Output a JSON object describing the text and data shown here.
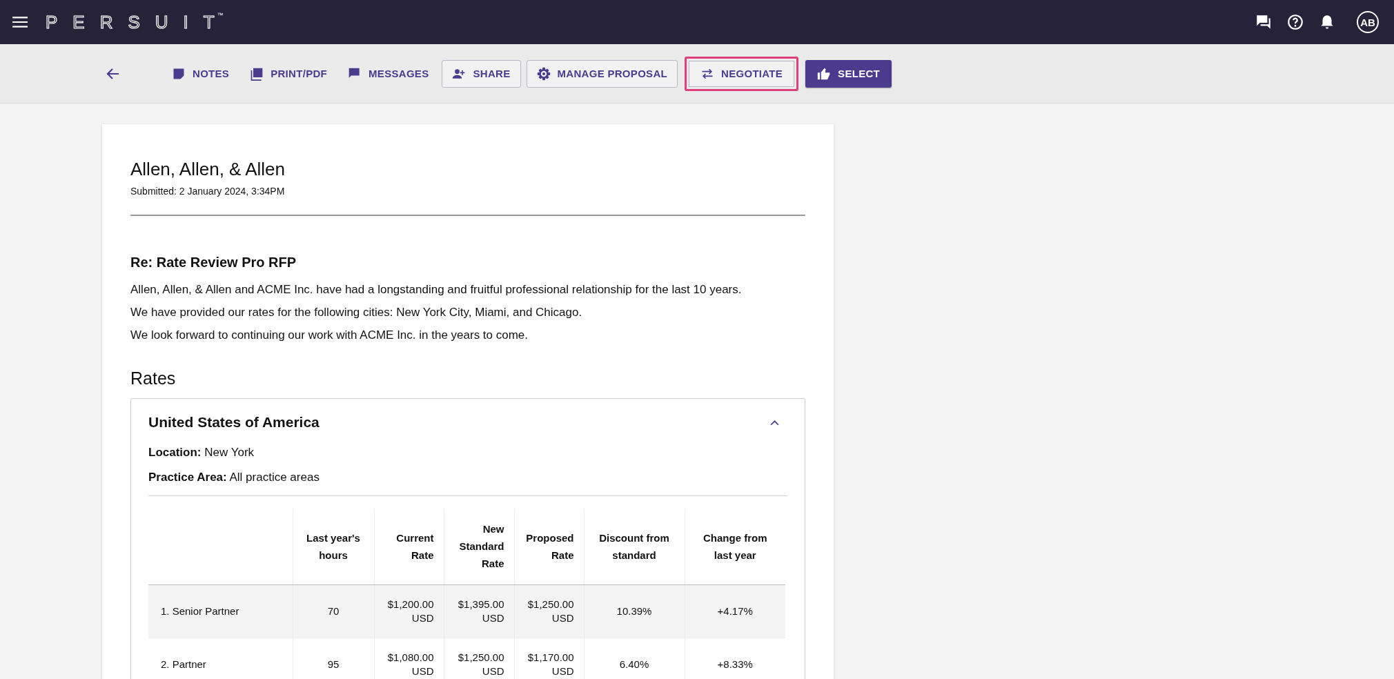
{
  "brand": {
    "logo": "PERSUIT",
    "trademark": "™"
  },
  "user": {
    "initials": "AB"
  },
  "actions": [
    {
      "kind": "text",
      "label": "NOTES",
      "highlighted": false
    },
    {
      "kind": "text",
      "label": "PRINT/PDF",
      "highlighted": false
    },
    {
      "kind": "text",
      "label": "MESSAGES",
      "highlighted": false
    },
    {
      "kind": "outlined",
      "label": "SHARE",
      "highlighted": false
    },
    {
      "kind": "outlined",
      "label": "MANAGE PROPOSAL",
      "highlighted": false
    },
    {
      "kind": "outlined",
      "label": "NEGOTIATE",
      "highlighted": true
    },
    {
      "kind": "primary",
      "label": "SELECT",
      "highlighted": false
    }
  ],
  "proposal": {
    "firm": "Allen, Allen, & Allen",
    "submitted": "Submitted: 2 January 2024, 3:34PM",
    "subject": "Re: Rate Review Pro RFP",
    "paragraphs": [
      "Allen, Allen, & Allen and ACME Inc. have had a longstanding and fruitful professional relationship for the last 10 years.",
      "We have provided our rates for the following cities: New York City, Miami, and Chicago.",
      "We look forward to continuing our work with ACME Inc. in the years to come."
    ]
  },
  "rates": {
    "heading": "Rates",
    "region": "United States of America",
    "expanded": true,
    "details": [
      "**Location:** New York",
      "**Practice Area:** All practice areas"
    ],
    "table": {
      "columns": [
        "",
        "Last year's hours",
        "Current Rate",
        "New Standard Rate",
        "Proposed Rate",
        "Discount from standard",
        "Change from last year"
      ],
      "rows": [
        {
          "cells": [
            "1. Senior Partner",
            "70",
            "$1,200.00 USD",
            "$1,395.00 USD",
            "$1,250.00 USD",
            "10.39%",
            "+4.17%"
          ],
          "shaded": true
        },
        {
          "cells": [
            "2. Partner",
            "95",
            "$1,080.00 USD",
            "$1,250.00 USD",
            "$1,170.00 USD",
            "6.40%",
            "+8.33%"
          ],
          "shaded": false
        }
      ]
    }
  }
}
